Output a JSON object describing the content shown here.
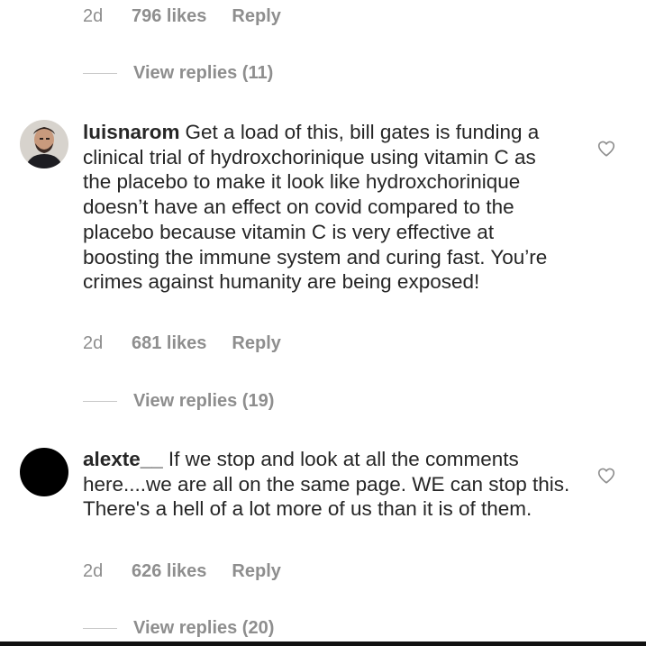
{
  "top_meta": {
    "time": "2d",
    "likes": "796 likes",
    "reply": "Reply"
  },
  "top_view_replies": "View replies (11)",
  "comments": [
    {
      "username": "luisnarom",
      "text": "Get a load of this, bill gates is funding a clinical trial of hydroxchorinique using vitamin C as the placebo to make it look like hydroxchorinique doesn’t have an effect on covid compared to the placebo because vitamin C is very effective at boosting the immune system and curing fast. You’re crimes against humanity are being exposed!",
      "time": "2d",
      "likes": "681 likes",
      "reply": "Reply",
      "view_replies": "View replies (19)",
      "like_icon": "heart-outline-icon",
      "avatar_colors": [
        "#d7d3cd",
        "#3a2a24",
        "#6b4a3c"
      ]
    },
    {
      "username": "alexte__",
      "text": "If we stop and look at all the comments here....we are all on the same page. WE can stop this. There's a hell of a lot more of us than it is of them.",
      "time": "2d",
      "likes": "626 likes",
      "reply": "Reply",
      "view_replies": "View replies (20)",
      "like_icon": "heart-outline-icon",
      "avatar_colors": [
        "#000000"
      ]
    }
  ],
  "colors": {
    "text": "#262626",
    "secondary": "#8e8e8e",
    "divider": "#c7c7c7",
    "background": "#ffffff"
  }
}
